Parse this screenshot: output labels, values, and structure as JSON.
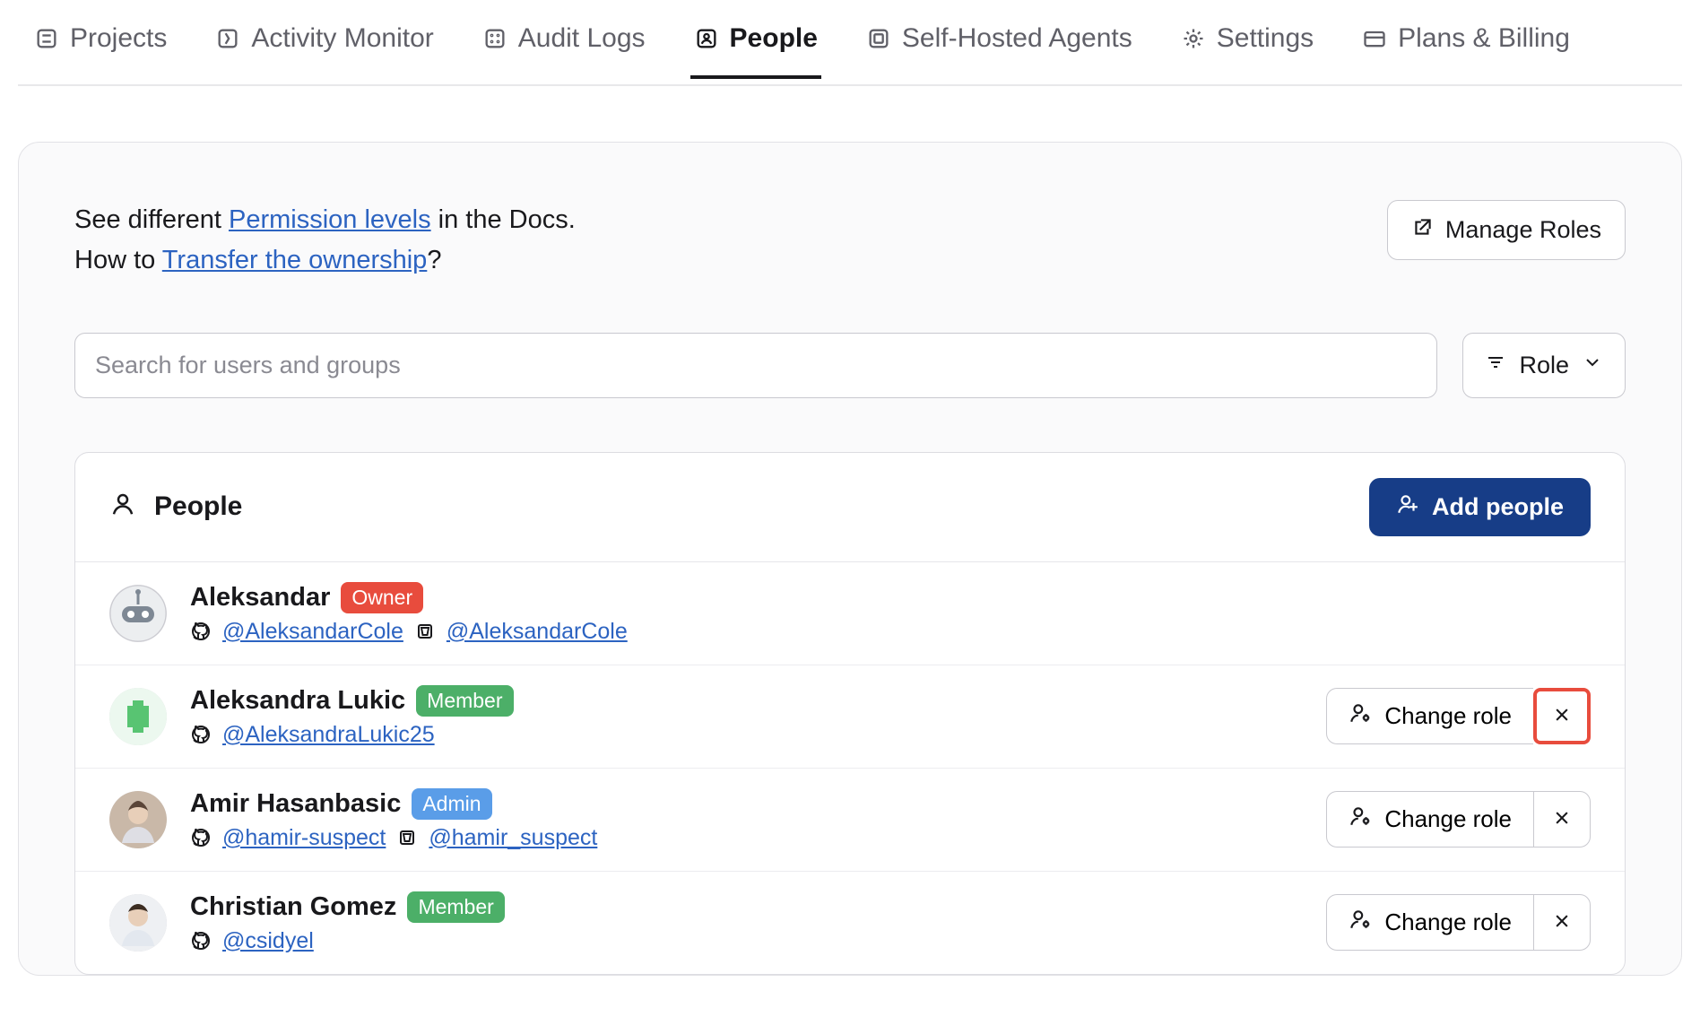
{
  "tabs": {
    "projects": "Projects",
    "activity": "Activity Monitor",
    "audit": "Audit Logs",
    "people": "People",
    "agents": "Self-Hosted Agents",
    "settings": "Settings",
    "billing": "Plans & Billing"
  },
  "info": {
    "line1_a": "See different ",
    "line1_link": "Permission levels",
    "line1_b": " in the Docs.",
    "line2_a": "How to ",
    "line2_link": "Transfer the ownership",
    "line2_b": "?"
  },
  "buttons": {
    "manage_roles": "Manage Roles",
    "role_filter": "Role",
    "add_people": "Add people",
    "change_role": "Change role"
  },
  "search": {
    "placeholder": "Search for users and groups"
  },
  "card": {
    "title": "People"
  },
  "roles": {
    "owner": "Owner",
    "member": "Member",
    "admin": "Admin"
  },
  "people": [
    {
      "name": "Aleksandar",
      "role": "owner",
      "gh": "@AleksandarCole",
      "bb": "@AleksandarCole"
    },
    {
      "name": "Aleksandra Lukic",
      "role": "member",
      "gh": "@AleksandraLukic25"
    },
    {
      "name": "Amir Hasanbasic",
      "role": "admin",
      "gh": "@hamir-suspect",
      "bb": "@hamir_suspect"
    },
    {
      "name": "Christian Gomez",
      "role": "member",
      "gh": "@csidyel"
    }
  ]
}
